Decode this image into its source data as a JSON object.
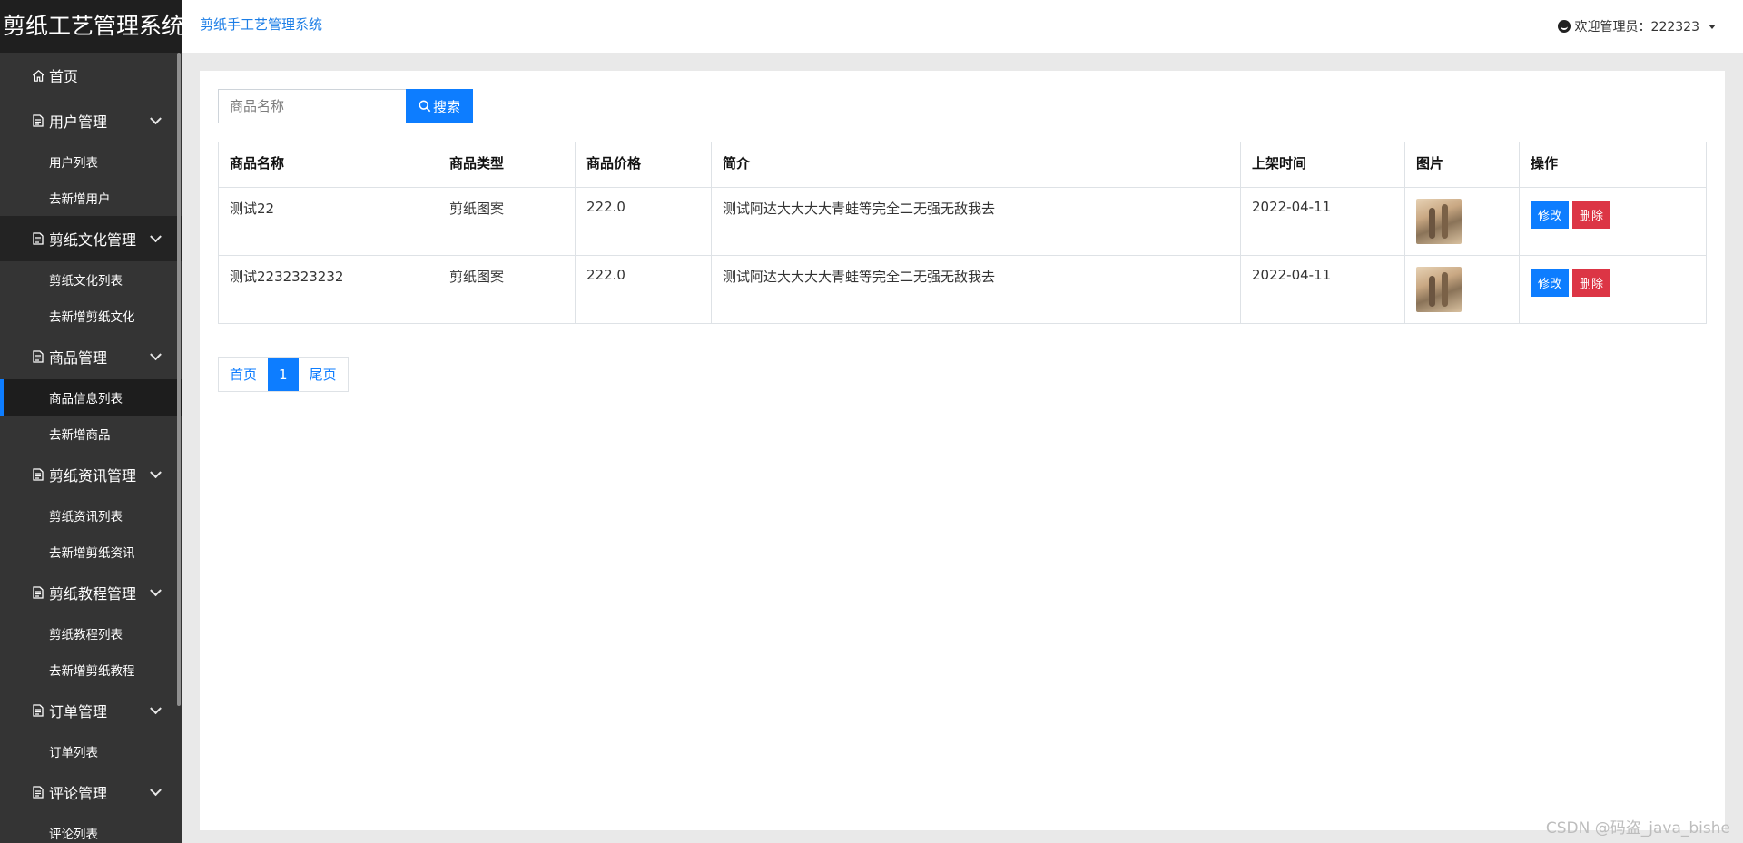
{
  "sidebar": {
    "brand": "剪纸工艺管理系统",
    "home": "首页",
    "groups": [
      {
        "label": "用户管理",
        "items": [
          "用户列表",
          "去新增用户"
        ]
      },
      {
        "label": "剪纸文化管理",
        "items": [
          "剪纸文化列表",
          "去新增剪纸文化"
        ]
      },
      {
        "label": "商品管理",
        "items": [
          "商品信息列表",
          "去新增商品"
        ]
      },
      {
        "label": "剪纸资讯管理",
        "items": [
          "剪纸资讯列表",
          "去新增剪纸资讯"
        ]
      },
      {
        "label": "剪纸教程管理",
        "items": [
          "剪纸教程列表",
          "去新增剪纸教程"
        ]
      },
      {
        "label": "订单管理",
        "items": [
          "订单列表"
        ]
      },
      {
        "label": "评论管理",
        "items": [
          "评论列表"
        ]
      }
    ]
  },
  "header": {
    "title": "剪纸手工艺管理系统",
    "user": "欢迎管理员：222323"
  },
  "search": {
    "placeholder": "商品名称",
    "button": "搜索"
  },
  "table": {
    "headers": [
      "商品名称",
      "商品类型",
      "商品价格",
      "简介",
      "上架时间",
      "图片",
      "操作"
    ],
    "rows": [
      {
        "name": "测试22",
        "type": "剪纸图案",
        "price": "222.0",
        "intro": "测试阿达大大大大青蛙等完全二无强无敌我去",
        "date": "2022-04-11"
      },
      {
        "name": "测试2232323232",
        "type": "剪纸图案",
        "price": "222.0",
        "intro": "测试阿达大大大大青蛙等完全二无强无敌我去",
        "date": "2022-04-11"
      }
    ],
    "edit_label": "修改",
    "delete_label": "删除"
  },
  "pager": {
    "first": "首页",
    "current": "1",
    "last": "尾页"
  },
  "watermark": "CSDN @码盗_java_bishe"
}
